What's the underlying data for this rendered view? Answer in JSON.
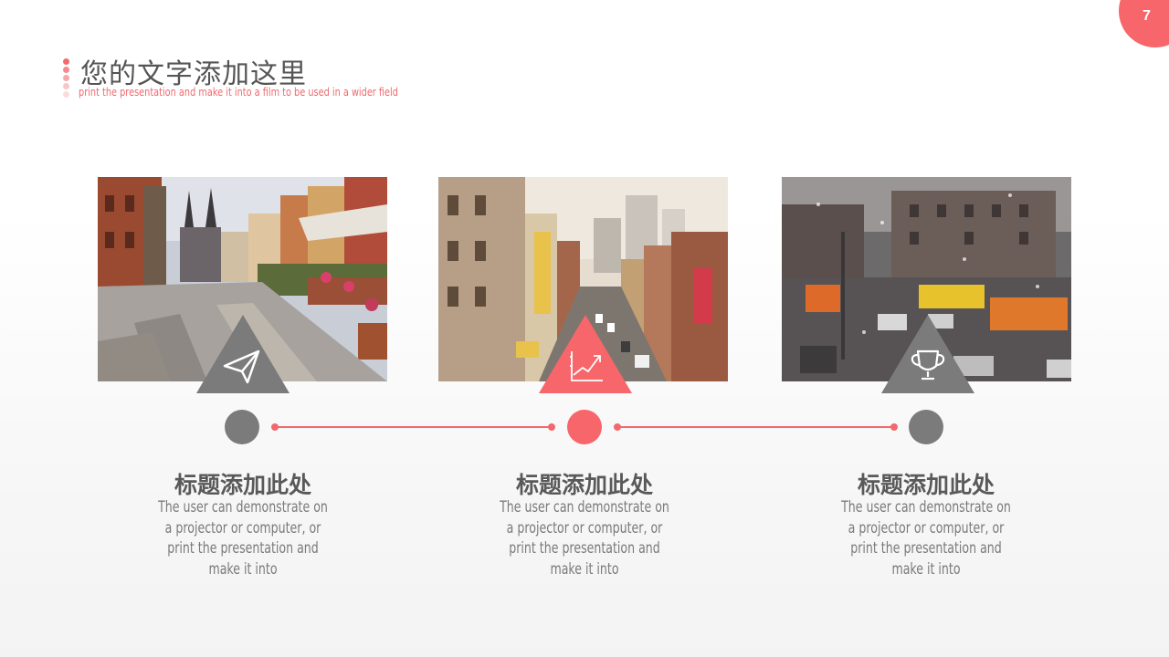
{
  "page_number": "7",
  "header": {
    "title": "您的文字添加这里",
    "subtitle": "print the presentation and make it into a film to be used in a wider field"
  },
  "colors": {
    "accent": "#f7666a",
    "gray": "#7b7b7b",
    "text": "#595959"
  },
  "timeline": [
    {
      "title": "标题添加此处",
      "description": "The user can demonstrate on a projector or computer, or print the presentation and make it into",
      "icon": "paper-plane-icon",
      "active": false
    },
    {
      "title": "标题添加此处",
      "description": "The user can demonstrate on a projector or computer, or print the presentation and make it into",
      "icon": "growth-chart-icon",
      "active": true
    },
    {
      "title": "标题添加此处",
      "description": "The user can demonstrate on a projector or computer, or print the presentation and make it into",
      "icon": "trophy-icon",
      "active": false
    }
  ]
}
